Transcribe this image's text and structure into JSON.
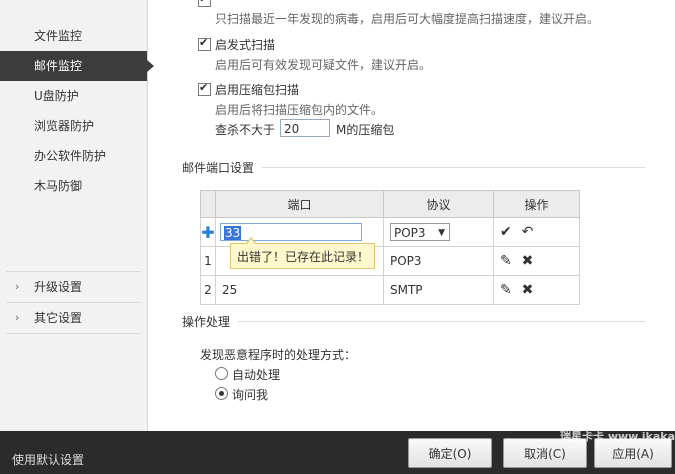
{
  "sidebar": {
    "items": [
      {
        "label": "文件监控"
      },
      {
        "label": "邮件监控"
      },
      {
        "label": "U盘防护"
      },
      {
        "label": "浏览器防护"
      },
      {
        "label": "办公软件防护"
      },
      {
        "label": "木马防御"
      }
    ],
    "groups": [
      {
        "label": "升级设置"
      },
      {
        "label": "其它设置"
      }
    ]
  },
  "scan_options": {
    "opt1_hint": "只扫描最近一年发现的病毒，启用后可大幅度提高扫描速度，建议开启。",
    "opt2_label": "启发式扫描",
    "opt2_hint": "启用后可有效发现可疑文件，建议开启。",
    "opt3_label": "启用压缩包扫描",
    "opt3_hint": "启用后将扫描压缩包内的文件。",
    "size_prefix": "查杀不大于",
    "size_value": "20",
    "size_suffix": "M的压缩包"
  },
  "ports": {
    "section_title": "邮件端口设置",
    "headers": {
      "port": "端口",
      "protocol": "协议",
      "action": "操作"
    },
    "edit_row": {
      "port": "33",
      "protocol": "POP3"
    },
    "rows": [
      {
        "index": "1",
        "port": "",
        "protocol": "POP3"
      },
      {
        "index": "2",
        "port": "25",
        "protocol": "SMTP"
      }
    ],
    "error_tooltip": "出错了！已存在此记录！"
  },
  "handling": {
    "section_title": "操作处理",
    "question": "发现恶意程序时的处理方式：",
    "options": [
      {
        "label": "自动处理",
        "selected": false
      },
      {
        "label": "询问我",
        "selected": true
      }
    ]
  },
  "footer": {
    "default_label": "使用默认设置",
    "ok": "确定(O)",
    "cancel": "取消(C)",
    "apply": "应用(A)"
  },
  "watermark": "瑞星卡卡 www.ikaka.com"
}
